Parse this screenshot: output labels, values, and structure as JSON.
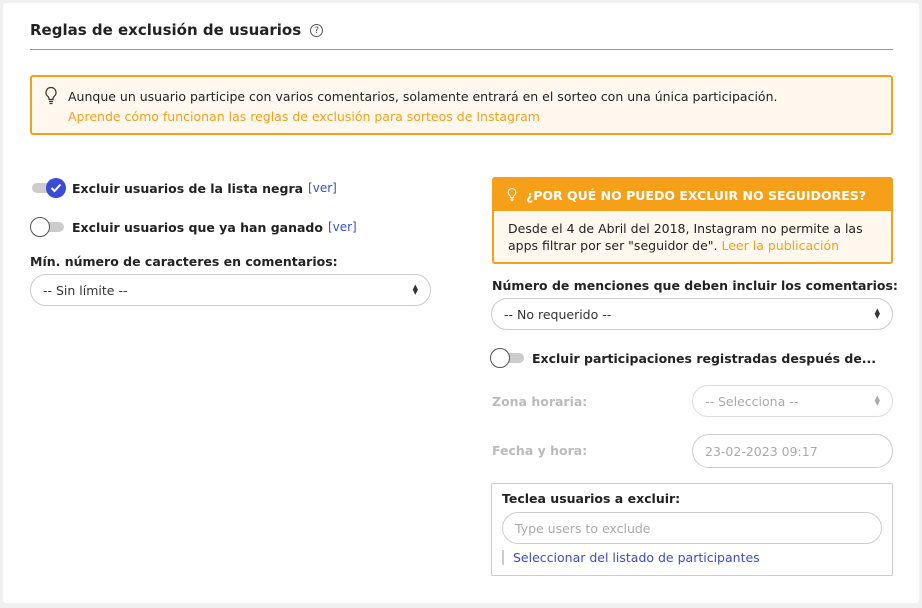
{
  "header": {
    "title": "Reglas de exclusión de usuarios",
    "help_glyph": "?"
  },
  "notice": {
    "text": "Aunque un usuario participe con varios comentarios, solamente entrará en el sorteo con una única participación.",
    "link": "Aprende cómo funcionan las reglas de exclusión para sorteos de Instagram",
    "icon": "lightbulb-icon"
  },
  "left": {
    "blacklist": {
      "label": "Excluir usuarios de la lista negra",
      "ver": "[ver]",
      "enabled": true
    },
    "winners": {
      "label": "Excluir usuarios que ya han ganado",
      "ver": "[ver]",
      "enabled": false
    },
    "min_chars": {
      "label": "Mín. número de caracteres en comentarios:",
      "value": "-- Sin límite --"
    }
  },
  "right": {
    "warning": {
      "title": "¿POR QUÉ NO PUEDO EXCLUIR NO SEGUIDORES?",
      "text": "Desde el 4 de Abril del 2018, Instagram no permite a las apps filtrar por ser \"seguidor de\".",
      "link": "Leer la publicación"
    },
    "mentions": {
      "label": "Número de menciones que deben incluir los comentarios:",
      "value": "-- No requerido --"
    },
    "after_date": {
      "label": "Excluir participaciones registradas después de...",
      "enabled": false
    },
    "timezone": {
      "label": "Zona horaria:",
      "value": "-- Selecciona --"
    },
    "datetime": {
      "label": "Fecha y hora:",
      "value": "23-02-2023 09:17"
    },
    "exclude_users": {
      "label": "Teclea usuarios a excluir:",
      "placeholder": "Type users to exclude",
      "select_link": "Seleccionar del listado de participantes"
    }
  },
  "colors": {
    "accent": "#f6a01a",
    "primary": "#3a4bd6"
  }
}
